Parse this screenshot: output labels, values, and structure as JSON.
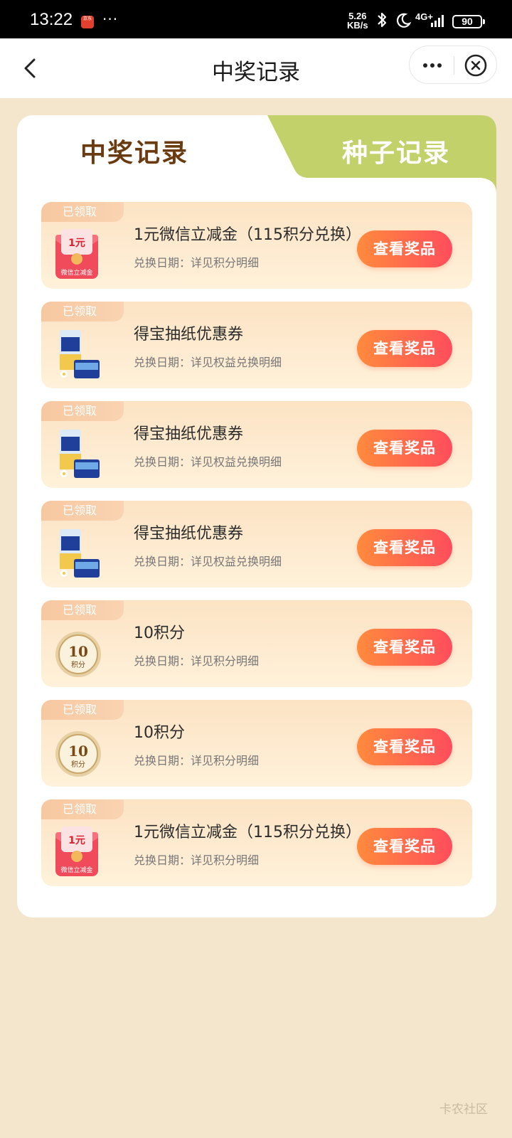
{
  "status_bar": {
    "time": "13:22",
    "app_badge": "京东",
    "more_dots": "···",
    "speed_value": "5.26",
    "speed_unit": "KB/s",
    "network": "4G+",
    "battery": "90"
  },
  "nav": {
    "title": "中奖记录"
  },
  "tabs": {
    "active": "中奖记录",
    "inactive": "种子记录"
  },
  "records": [
    {
      "status": "已领取",
      "name": "1元微信立减金（115积分兑换）",
      "date": "兑换日期：详见积分明细",
      "button": "查看奖品",
      "thumb": "red-packet-icon",
      "thumb_amount": "1元",
      "thumb_caption": "微信立减金"
    },
    {
      "status": "已领取",
      "name": "得宝抽纸优惠券",
      "date": "兑换日期：详见权益兑换明细",
      "button": "查看奖品",
      "thumb": "tissue-pack-icon",
      "thumb_amount": "",
      "thumb_caption": ""
    },
    {
      "status": "已领取",
      "name": "得宝抽纸优惠券",
      "date": "兑换日期：详见权益兑换明细",
      "button": "查看奖品",
      "thumb": "tissue-pack-icon",
      "thumb_amount": "",
      "thumb_caption": ""
    },
    {
      "status": "已领取",
      "name": "得宝抽纸优惠券",
      "date": "兑换日期：详见权益兑换明细",
      "button": "查看奖品",
      "thumb": "tissue-pack-icon",
      "thumb_amount": "",
      "thumb_caption": ""
    },
    {
      "status": "已领取",
      "name": "10积分",
      "date": "兑换日期：详见积分明细",
      "button": "查看奖品",
      "thumb": "points-coin-icon",
      "thumb_amount": "10",
      "thumb_caption": "积分"
    },
    {
      "status": "已领取",
      "name": "10积分",
      "date": "兑换日期：详见积分明细",
      "button": "查看奖品",
      "thumb": "points-coin-icon",
      "thumb_amount": "10",
      "thumb_caption": "积分"
    },
    {
      "status": "已领取",
      "name": "1元微信立减金（115积分兑换）",
      "date": "兑换日期：详见积分明细",
      "button": "查看奖品",
      "thumb": "red-packet-icon",
      "thumb_amount": "1元",
      "thumb_caption": "微信立减金"
    }
  ],
  "watermark": "卡农社区",
  "colors": {
    "page_bg": "#f3e6cc",
    "tab_inactive_bg": "#c2d16a",
    "tab_active_text": "#6a3b10",
    "button_gradient_start": "#ff8b3c",
    "button_gradient_end": "#ff4d5c"
  }
}
